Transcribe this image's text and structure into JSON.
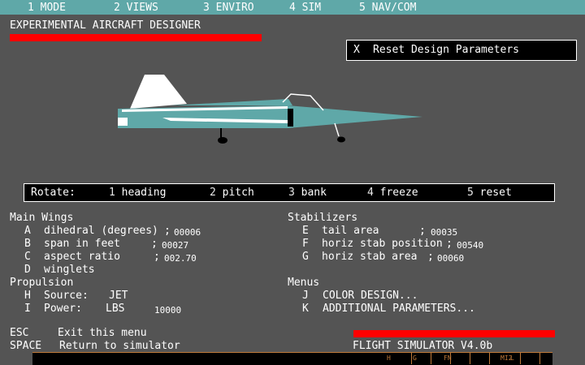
{
  "menubar": {
    "items": [
      {
        "label": "1 MODE"
      },
      {
        "label": "2 VIEWS"
      },
      {
        "label": "3 ENVIRO"
      },
      {
        "label": "4 SIM"
      },
      {
        "label": "5 NAV/COM"
      }
    ]
  },
  "header": {
    "title": "EXPERIMENTAL AIRCRAFT DESIGNER"
  },
  "reset": {
    "key": "X",
    "label": "Reset Design Parameters"
  },
  "rotate": {
    "label": "Rotate:",
    "options": [
      {
        "key": "1",
        "label": "heading"
      },
      {
        "key": "2",
        "label": "pitch"
      },
      {
        "key": "3",
        "label": "bank"
      },
      {
        "key": "4",
        "label": "freeze"
      },
      {
        "key": "5",
        "label": "reset"
      }
    ]
  },
  "main_wings": {
    "title": "Main Wings",
    "items": [
      {
        "key": "A",
        "label": "dihedral (degrees)",
        "sep": ";",
        "value": "00006"
      },
      {
        "key": "B",
        "label": "span in feet",
        "sep": ";",
        "value": "00027"
      },
      {
        "key": "C",
        "label": "aspect ratio",
        "sep": ";",
        "value": "002.70"
      },
      {
        "key": "D",
        "label": "winglets",
        "sep": "",
        "value": ""
      }
    ]
  },
  "stabilizers": {
    "title": "Stabilizers",
    "items": [
      {
        "key": "E",
        "label": "tail area",
        "sep": ";",
        "value": "00035"
      },
      {
        "key": "F",
        "label": "horiz stab position",
        "sep": ";",
        "value": "00540"
      },
      {
        "key": "G",
        "label": "horiz stab area",
        "sep": ";",
        "value": "00060"
      }
    ]
  },
  "propulsion": {
    "title": "Propulsion",
    "source": {
      "key": "H",
      "label": "Source:",
      "value": "JET"
    },
    "power": {
      "key": "I",
      "label": "Power:",
      "unit": "LBS",
      "value": "10000"
    }
  },
  "menus": {
    "title": "Menus",
    "items": [
      {
        "key": "J",
        "label": "COLOR DESIGN..."
      },
      {
        "key": "K",
        "label": "ADDITIONAL PARAMETERS..."
      }
    ]
  },
  "footer": {
    "esc": {
      "key": "ESC",
      "label": "Exit this menu"
    },
    "space": {
      "key": "SPACE",
      "label": "Return to simulator"
    },
    "version": "FLIGHT SIMULATOR V4.0b"
  },
  "instrument_strip": {
    "labels": [
      "H",
      "G",
      "FN",
      "MI2",
      "L"
    ]
  },
  "colors": {
    "background": "#545454",
    "menubar": "#5fa8a8",
    "accent_red": "#ff0000",
    "aircraft_body": "#5fa8a8",
    "aircraft_white": "#ffffff",
    "panel": "#000000"
  },
  "icons": {
    "aircraft": "experimental-jet-side-view"
  }
}
